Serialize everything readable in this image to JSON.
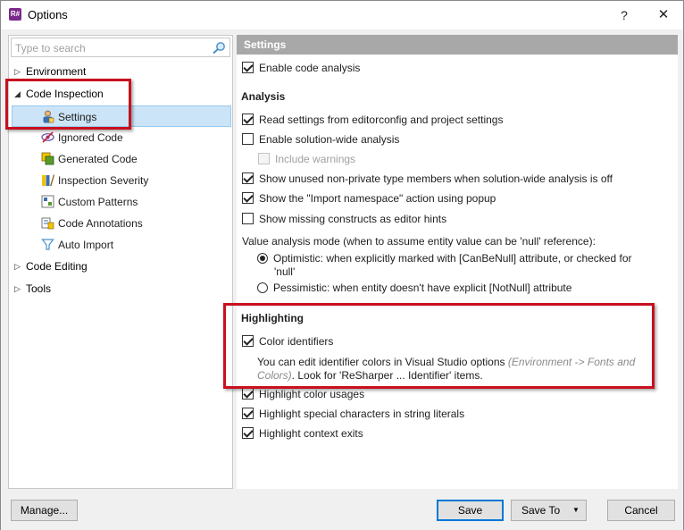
{
  "window": {
    "title": "Options",
    "app_icon_text": "R#",
    "help_label": "?",
    "close_label": "✕"
  },
  "sidebar": {
    "search_placeholder": "Type to search",
    "items": [
      {
        "label": "Environment",
        "expander": "▷"
      },
      {
        "label": "Code Inspection",
        "expander": "◢"
      },
      {
        "label": "Settings",
        "icon": "settings-person-icon"
      },
      {
        "label": "Ignored Code",
        "icon": "ignored-code-icon"
      },
      {
        "label": "Generated Code",
        "icon": "generated-code-icon"
      },
      {
        "label": "Inspection Severity",
        "icon": "inspection-severity-icon"
      },
      {
        "label": "Custom Patterns",
        "icon": "custom-patterns-icon"
      },
      {
        "label": "Code Annotations",
        "icon": "code-annotations-icon"
      },
      {
        "label": "Auto Import",
        "icon": "funnel-icon"
      },
      {
        "label": "Code Editing",
        "expander": "▷"
      },
      {
        "label": "Tools",
        "expander": "▷"
      }
    ]
  },
  "settings": {
    "header": "Settings",
    "enable_code_analysis": "Enable code analysis",
    "analysis_title": "Analysis",
    "read_editorconfig": "Read settings from editorconfig and project settings",
    "enable_solution_wide": "Enable solution-wide analysis",
    "include_warnings": "Include warnings",
    "show_unused": "Show unused non-private type members when solution-wide analysis is off",
    "show_import_namespace": "Show the \"Import namespace\" action using popup",
    "show_missing_constructs": "Show missing constructs as editor hints",
    "value_analysis_label": "Value analysis mode (when to assume entity value can be 'null' reference):",
    "optimistic_line1": "Optimistic: when explicitly marked with [CanBeNull] attribute, or checked for",
    "optimistic_line2": "'null'",
    "pessimistic": "Pessimistic: when entity doesn't have explicit [NotNull] attribute",
    "highlighting_title": "Highlighting",
    "color_identifiers": "Color identifiers",
    "note_line1_a": "You can edit identifier colors in Visual Studio options ",
    "note_line1_b": "(Environment -> Fonts and",
    "note_line2_a": "Colors)",
    "note_line2_b": ". Look for 'ReSharper ... Identifier' items.",
    "highlight_color_usages": "Highlight color usages",
    "highlight_special_chars": "Highlight special characters in string literals",
    "highlight_context_exits": "Highlight context exits"
  },
  "buttons": {
    "manage": "Manage...",
    "save": "Save",
    "save_to": "Save To",
    "save_to_arrow": "▼",
    "cancel": "Cancel"
  },
  "colors": {
    "accent_frame": "#c8101e",
    "selection": "#cce4f7",
    "header_bg": "#a8a8a8"
  }
}
